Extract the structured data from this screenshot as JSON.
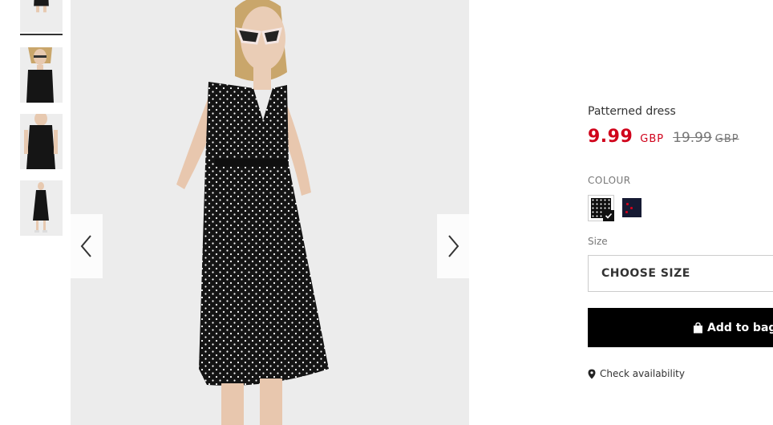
{
  "gallery": {
    "thumbnails": [
      "thumb-1",
      "thumb-2",
      "thumb-3",
      "thumb-4"
    ],
    "active_index": 0
  },
  "product": {
    "name": "Patterned dress",
    "price_now": "9.99",
    "currency_now": "GBP",
    "price_old": "19.99",
    "currency_old": "GBP",
    "sale_color": "#d0021b"
  },
  "colour": {
    "label": "COLOUR",
    "options": [
      "black-polka-dot",
      "navy-print"
    ],
    "selected": "black-polka-dot"
  },
  "size": {
    "label": "Size",
    "select_value": "CHOOSE SIZE"
  },
  "actions": {
    "add_to_bag": "Add to bag",
    "check_availability": "Check availability"
  }
}
